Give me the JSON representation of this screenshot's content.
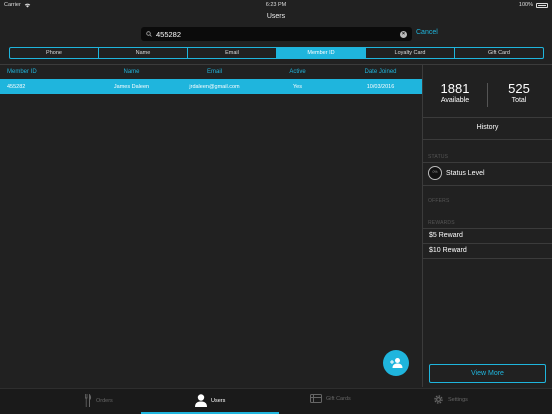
{
  "status_bar": {
    "carrier": "Carrier",
    "time": "6:23 PM",
    "battery": "100%"
  },
  "nav": {
    "title": "Users"
  },
  "search": {
    "value": "455282",
    "cancel_label": "Cancel"
  },
  "segments": [
    {
      "label": "Phone",
      "active": false
    },
    {
      "label": "Name",
      "active": false
    },
    {
      "label": "Email",
      "active": false
    },
    {
      "label": "Member ID",
      "active": true
    },
    {
      "label": "Loyalty Card",
      "active": false
    },
    {
      "label": "Gift Card",
      "active": false
    }
  ],
  "table": {
    "columns": [
      "Member ID",
      "Name",
      "Email",
      "Active",
      "Date Joined"
    ],
    "rows": [
      [
        "455282",
        "James Daleen",
        "jrdaleen@gmail.com",
        "Yes",
        "10/03/2016"
      ]
    ]
  },
  "side_panel": {
    "available_value": "1881",
    "available_label": "Available",
    "total_value": "525",
    "total_label": "Total",
    "history_label": "History",
    "status_section": "STATUS",
    "status_badge": "0%",
    "status_level": "Status Level",
    "offers_section": "OFFERS",
    "rewards_section": "REWARDS",
    "rewards": [
      "$5 Reward",
      "$10 Reward"
    ],
    "view_more_label": "View More"
  },
  "tabs": [
    {
      "label": "Orders",
      "icon": "fork-knife-icon",
      "active": false
    },
    {
      "label": "Users",
      "icon": "user-icon",
      "active": true
    },
    {
      "label": "Gift Cards",
      "icon": "gift-card-icon",
      "active": false
    },
    {
      "label": "Settings",
      "icon": "gear-icon",
      "active": false
    }
  ],
  "colors": {
    "accent": "#1fb5dd",
    "background": "#212121",
    "tabbar": "#1a1a1a"
  }
}
